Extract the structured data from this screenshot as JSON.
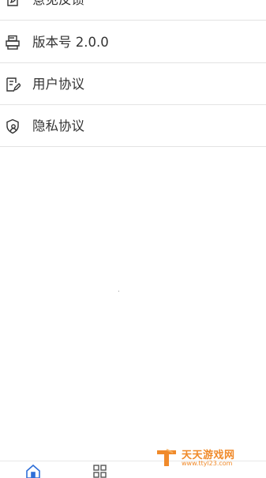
{
  "settings_list": {
    "items": [
      {
        "label": "意见反馈",
        "icon": "edit-icon"
      },
      {
        "label": "版本号 2.0.0",
        "icon": "printer-icon"
      },
      {
        "label": "用户协议",
        "icon": "document-edit-icon"
      },
      {
        "label": "隐私协议",
        "icon": "shield-user-icon"
      }
    ]
  },
  "tabbar": {
    "tabs": [
      {
        "icon": "home-icon"
      },
      {
        "icon": "apps-grid-icon"
      }
    ]
  },
  "watermark": {
    "name": "天天游戏网",
    "url": "www.ttyl23.com"
  },
  "colors": {
    "text": "#333333",
    "divider": "#e3e3e3",
    "watermark": "#f08a2a",
    "active_tab": "#2f6fd8"
  }
}
